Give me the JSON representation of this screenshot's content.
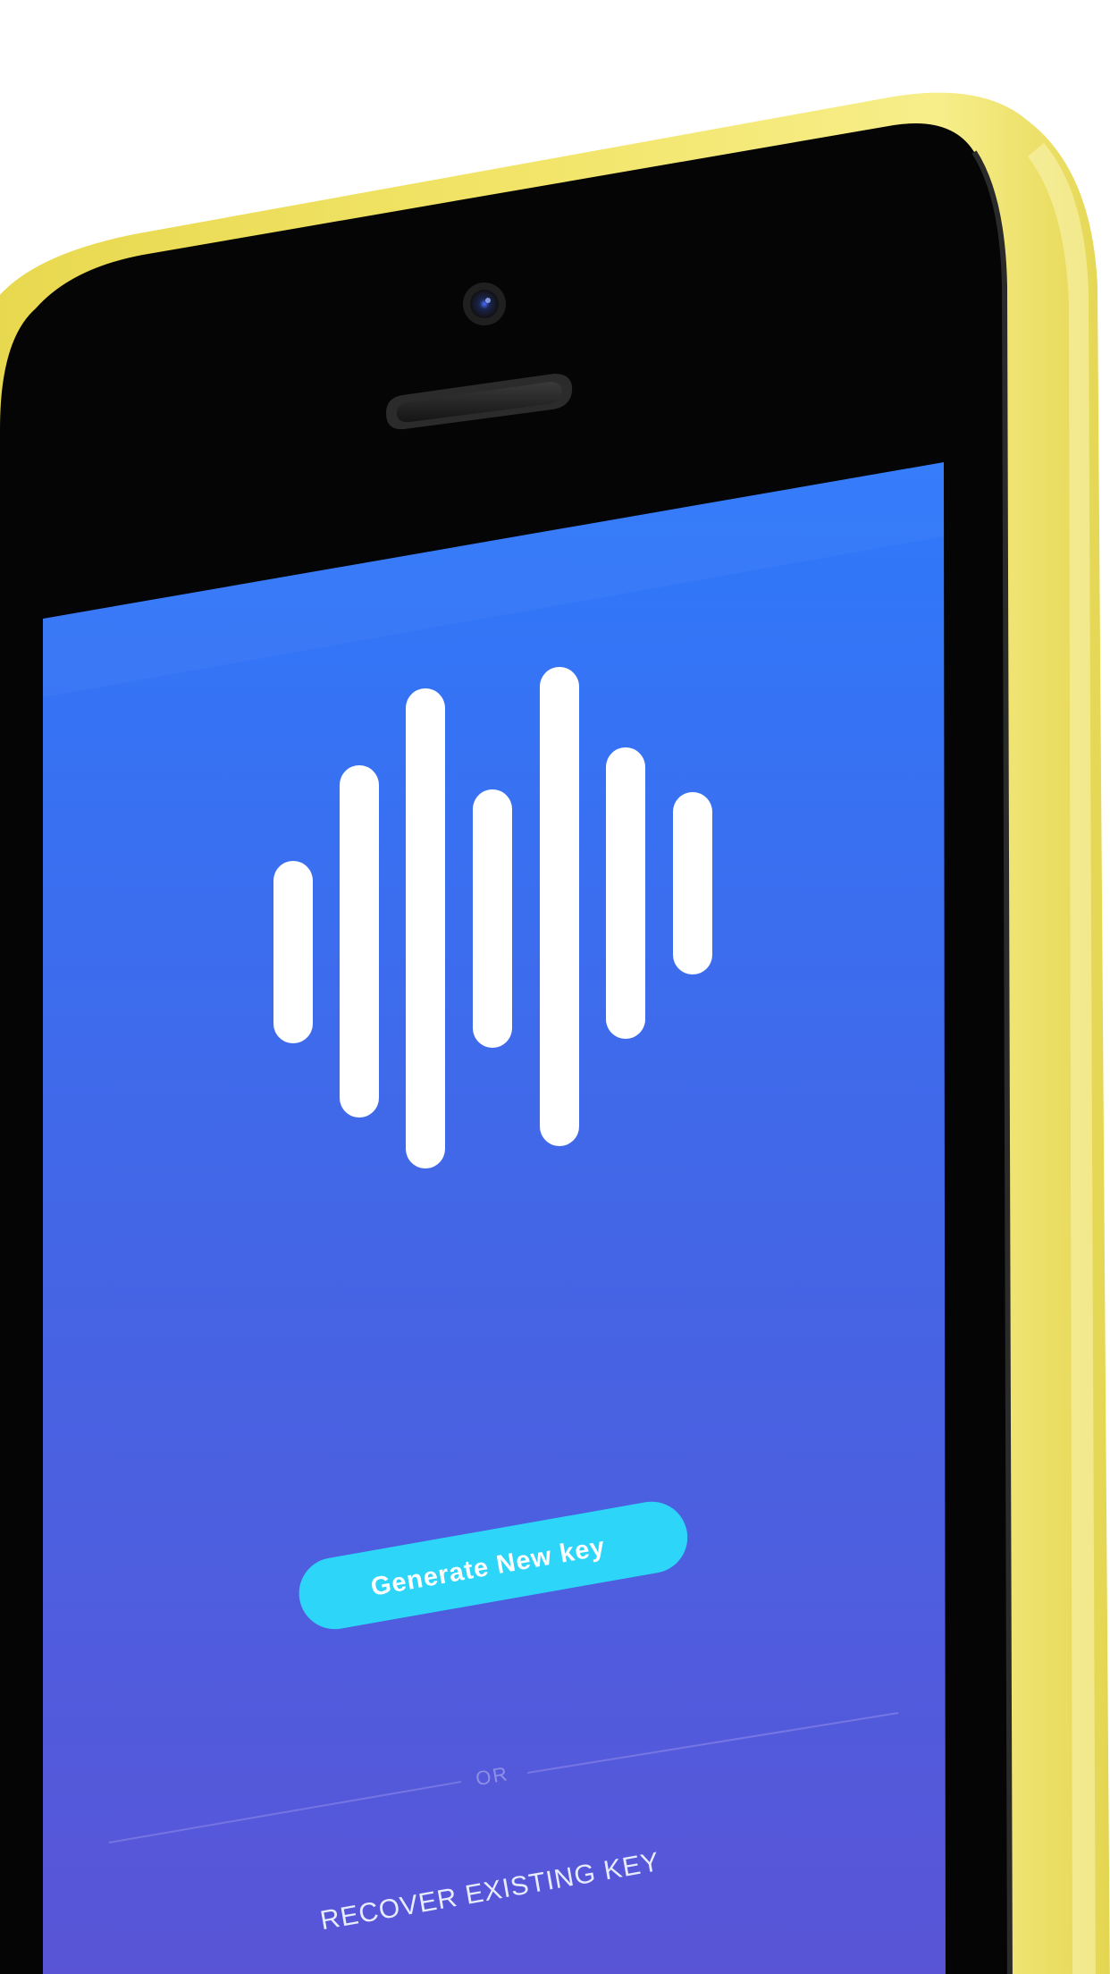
{
  "screen": {
    "primary_button_label": "Generate New key",
    "divider_label": "OR",
    "secondary_link_label": "RECOVER EXISTING KEY"
  },
  "logo": {
    "icon": "sound-wave-icon",
    "bar_count": 7
  },
  "colors": {
    "phone_shell": "#ebde5f",
    "phone_bezel": "#050505",
    "screen_gradient_top": "#2f79fb",
    "screen_gradient_bottom": "#5a54d6",
    "primary_button": "#2dd6f9",
    "logo_bars": "#ffffff"
  }
}
